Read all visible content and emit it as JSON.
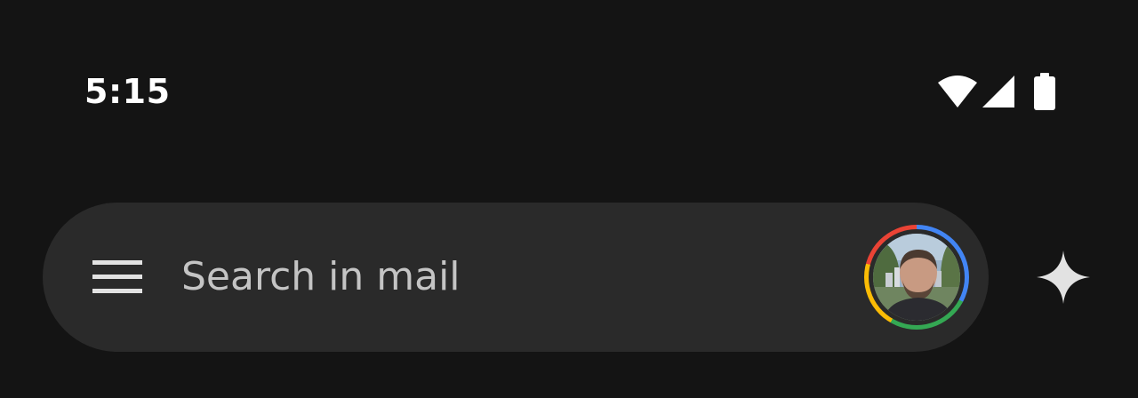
{
  "status_bar": {
    "time": "5:15",
    "icons": [
      "wifi-icon",
      "cellular-signal-icon",
      "battery-icon"
    ]
  },
  "search_bar": {
    "menu_icon": "hamburger-menu-icon",
    "placeholder": "Search in mail",
    "avatar_icon": "account-avatar",
    "ring_colors": [
      "#4285f4",
      "#34a853",
      "#fbbc05",
      "#ea4335"
    ]
  },
  "actions": {
    "gemini_icon": "sparkle-icon"
  },
  "colors": {
    "background": "#141414",
    "search_bar": "#2a2a2a",
    "placeholder_text": "#c4c4c4",
    "icon": "#e2e2e2"
  }
}
